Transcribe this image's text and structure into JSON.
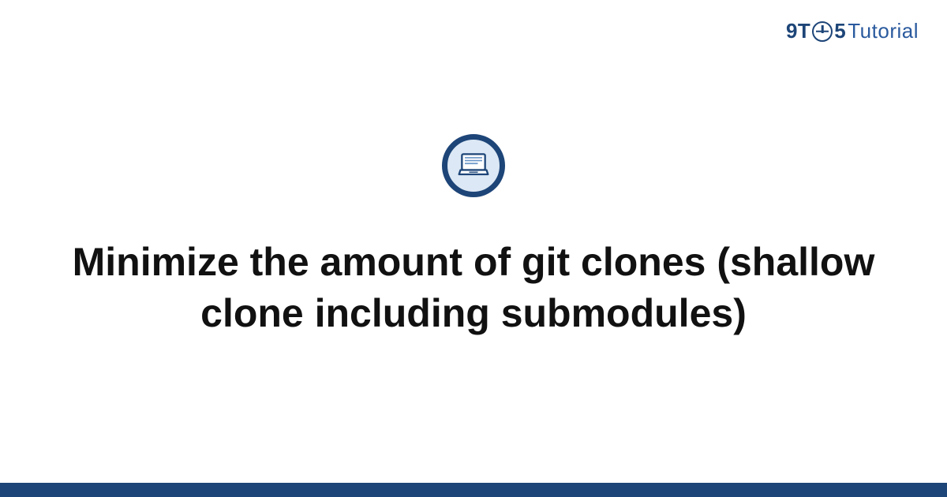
{
  "brand": {
    "prefix": "9T",
    "suffix": "5",
    "word": "Tutorial"
  },
  "page": {
    "title": "Minimize the amount of git clones (shallow clone including submodules)"
  },
  "colors": {
    "brand_primary": "#1d4578",
    "icon_bg": "#dce8f5",
    "text": "#111111"
  }
}
